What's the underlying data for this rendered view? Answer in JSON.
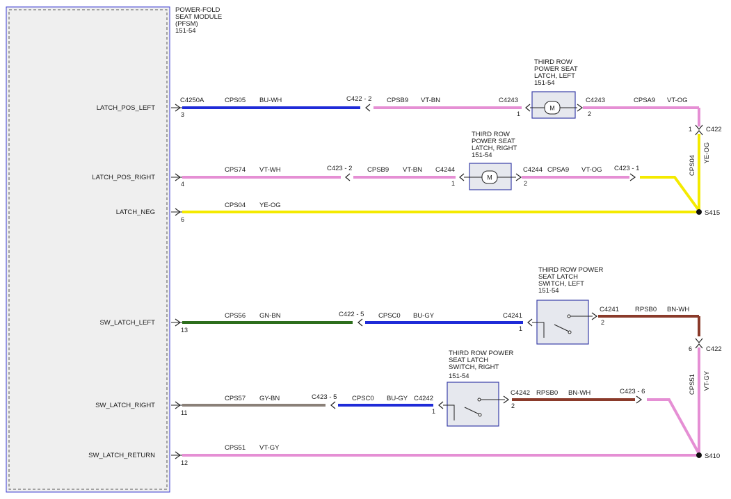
{
  "module": {
    "name_lines": [
      "POWER-FOLD",
      "SEAT MODULE",
      "(PFSM)",
      "151-54"
    ]
  },
  "signals": {
    "latch_pos_left": "LATCH_POS_LEFT",
    "latch_pos_right": "LATCH_POS_RIGHT",
    "latch_neg": "LATCH_NEG",
    "sw_latch_left": "SW_LATCH_LEFT",
    "sw_latch_right": "SW_LATCH_RIGHT",
    "sw_latch_return": "SW_LATCH_RETURN"
  },
  "pins": {
    "p3": "3",
    "p4": "4",
    "p6": "6",
    "p13": "13",
    "p11": "11",
    "p12": "12"
  },
  "connectors": {
    "c4250a": "C4250A",
    "c422_2": "C422 - 2",
    "c4243_in": "C4243",
    "c4243_out": "C4243",
    "c4243_pin1": "1",
    "c4243_pin2": "2",
    "c422_1": "C422",
    "c422_1_pin": "1",
    "c423_2": "C423 - 2",
    "c4244_in": "C4244",
    "c4244_out": "C4244",
    "c4244_pin1": "1",
    "c4244_pin2": "2",
    "c423_1": "C423 - 1",
    "s415": "S415",
    "c422_5": "C422 - 5",
    "c4241_in": "C4241",
    "c4241_out": "C4241",
    "c4241_pin1": "1",
    "c4241_pin2": "2",
    "c422_6": "C422",
    "c422_6_pin": "6",
    "c423_5": "C423 - 5",
    "c4242_in": "C4242",
    "c4242_out": "C4242",
    "c4242_pin1": "1",
    "c4242_pin2": "2",
    "c423_6": "C423 - 6",
    "s410": "S410"
  },
  "wires": {
    "cps05": "CPS05",
    "bu_wh": "BU-WH",
    "cpsb9_a": "CPSB9",
    "vt_bn_a": "VT-BN",
    "cpsa9_a": "CPSA9",
    "vt_og_a": "VT-OG",
    "cps04_v": "CPS04",
    "ye_og_v": "YE-OG",
    "cps74": "CPS74",
    "vt_wh": "VT-WH",
    "cpsb9_b": "CPSB9",
    "vt_bn_b": "VT-BN",
    "cpsa9_b": "CPSA9",
    "vt_og_b": "VT-OG",
    "cps04": "CPS04",
    "ye_og": "YE-OG",
    "cps56": "CPS56",
    "gn_bn": "GN-BN",
    "cpsc0_a": "CPSC0",
    "bu_gy_a": "BU-GY",
    "rpsb0_a": "RPSB0",
    "bn_wh_a": "BN-WH",
    "cps51_v": "CPS51",
    "vt_gy_v": "VT-GY",
    "cps57": "CPS57",
    "gy_bn": "GY-BN",
    "cpsc0_b": "CPSC0",
    "bu_gy_b": "BU-GY",
    "rpsb0_b": "RPSB0",
    "bn_wh_b": "BN-WH",
    "cps51": "CPS51",
    "vt_gy": "VT-GY"
  },
  "components": {
    "latch_left": [
      "THIRD ROW",
      "POWER SEAT",
      "LATCH, LEFT",
      "151-54"
    ],
    "latch_right": [
      "THIRD ROW",
      "POWER SEAT",
      "LATCH, RIGHT",
      "151-54"
    ],
    "switch_left": [
      "THIRD ROW POWER",
      "SEAT LATCH",
      "SWITCH, LEFT",
      "151-54"
    ],
    "switch_right": [
      "THIRD ROW POWER",
      "SEAT LATCH",
      "SWITCH, RIGHT",
      "151-54"
    ],
    "motor_symbol": "M"
  },
  "colors": {
    "blue": "#1f2bd8",
    "violet": "#e58fd4",
    "yellow": "#f4ea00",
    "green": "#2d6e1d",
    "brown": "#8a3a2a",
    "gray": "#8a8078",
    "module_fill": "#efefef",
    "module_border": "#3b3bd1",
    "component_fill": "#e6e8ee",
    "component_border": "#3a3fa8"
  }
}
